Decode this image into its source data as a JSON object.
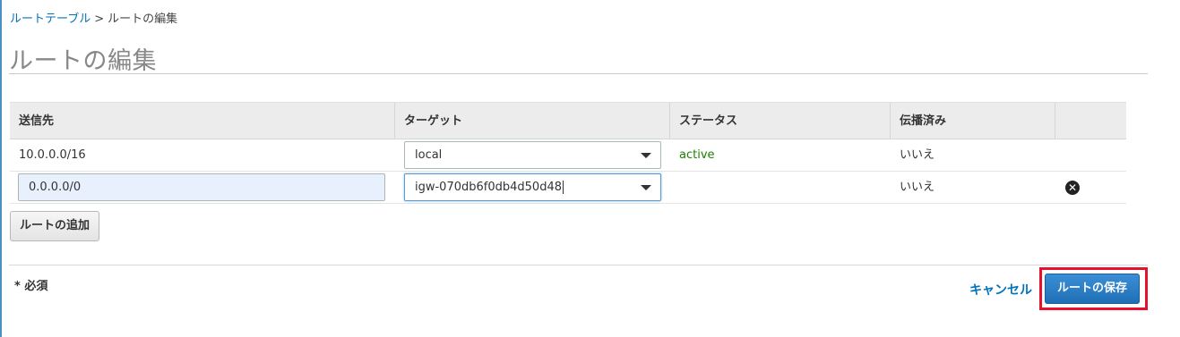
{
  "breadcrumb": {
    "parent": "ルートテーブル",
    "separator": ">",
    "current": "ルートの編集"
  },
  "page_title": "ルートの編集",
  "table": {
    "columns": [
      "送信先",
      "ターゲット",
      "ステータス",
      "伝播済み"
    ],
    "rows": [
      {
        "destination": "10.0.0.0/16",
        "target": "local",
        "status": "active",
        "propagated": "いいえ"
      },
      {
        "destination": "0.0.0.0/0",
        "target": "igw-070db6f0db4d50d48",
        "status": "",
        "propagated": "いいえ"
      }
    ]
  },
  "add_route_label": "ルートの追加",
  "required_note": "* 必須",
  "cancel_label": "キャンセル",
  "save_label": "ルートの保存",
  "icons": {
    "dropdown": "chevron-down-icon",
    "remove": "close-circle-icon"
  },
  "colors": {
    "link": "#0073bb",
    "active": "#1d8102",
    "primary": "#1f6fb5",
    "highlight": "#e8112d"
  }
}
